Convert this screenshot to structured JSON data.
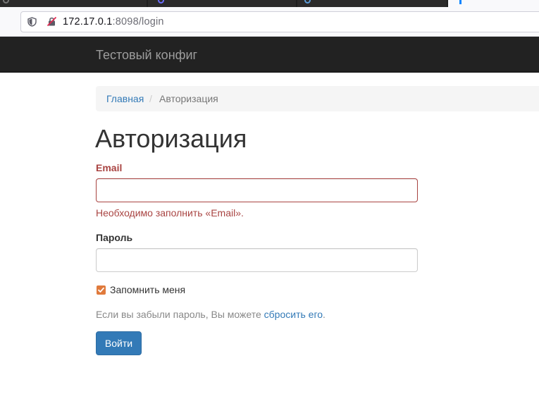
{
  "browser": {
    "url_host": "172.17.0.1",
    "url_rest": ":8098/login"
  },
  "navbar": {
    "brand": "Тестовый конфиг"
  },
  "breadcrumb": {
    "home": "Главная",
    "separator": "/",
    "current": "Авторизация"
  },
  "page": {
    "title": "Авторизация"
  },
  "form": {
    "email_label": "Email",
    "email_value": "",
    "email_error": "Необходимо заполнить «Email».",
    "password_label": "Пароль",
    "password_value": "",
    "remember_label": "Запомнить меня",
    "remember_checked": true,
    "reset_text_before": "Если вы забыли пароль, Вы можете ",
    "reset_link": "сбросить его",
    "reset_text_after": ".",
    "submit_label": "Войти"
  },
  "colors": {
    "error": "#a94442",
    "link": "#337ab7",
    "primary": "#337ab7",
    "navbar_bg": "#222222",
    "checkbox": "#e07a3c"
  },
  "icons": {
    "tracking_protection": "shield-icon",
    "connection_insecure": "lock-slash-icon",
    "checkbox": "checkmark-icon"
  }
}
